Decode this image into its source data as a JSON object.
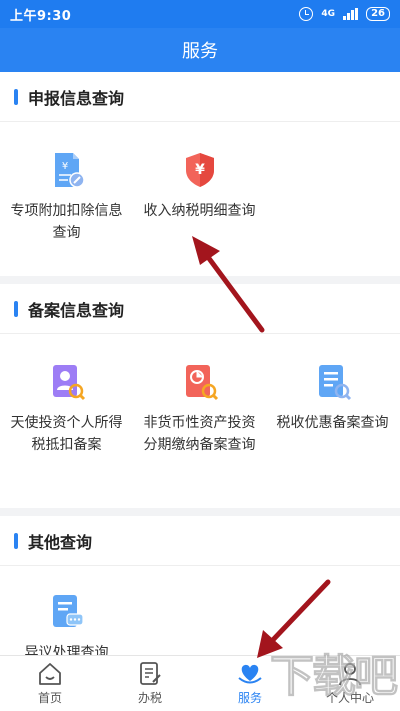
{
  "status_bar": {
    "time": "上午9:30",
    "network": "4G",
    "battery": "26"
  },
  "header": {
    "title": "服务"
  },
  "sections": [
    {
      "title": "申报信息查询",
      "items": [
        {
          "label": "专项附加扣除信息查询",
          "icon": "document-edit-icon"
        },
        {
          "label": "收入纳税明细查询",
          "icon": "yuan-shield-icon"
        }
      ]
    },
    {
      "title": "备案信息查询",
      "items": [
        {
          "label": "天使投资个人所得税抵扣备案",
          "icon": "person-search-icon"
        },
        {
          "label": "非货币性资产投资分期缴纳备案查询",
          "icon": "chart-search-icon"
        },
        {
          "label": "税收优惠备案查询",
          "icon": "list-search-icon"
        }
      ]
    },
    {
      "title": "其他查询",
      "items": [
        {
          "label": "异议处理查询",
          "icon": "document-chat-icon"
        }
      ]
    }
  ],
  "tabs": [
    {
      "label": "首页",
      "icon": "home-icon",
      "active": false
    },
    {
      "label": "办税",
      "icon": "document-pen-icon",
      "active": false
    },
    {
      "label": "服务",
      "icon": "heart-hand-icon",
      "active": true
    },
    {
      "label": "个人中心",
      "icon": "person-icon",
      "active": false
    }
  ],
  "colors": {
    "primary": "#2a83f2",
    "arrow": "#a3151d",
    "tab_active": "#2a83f2"
  },
  "watermark": "下载吧"
}
